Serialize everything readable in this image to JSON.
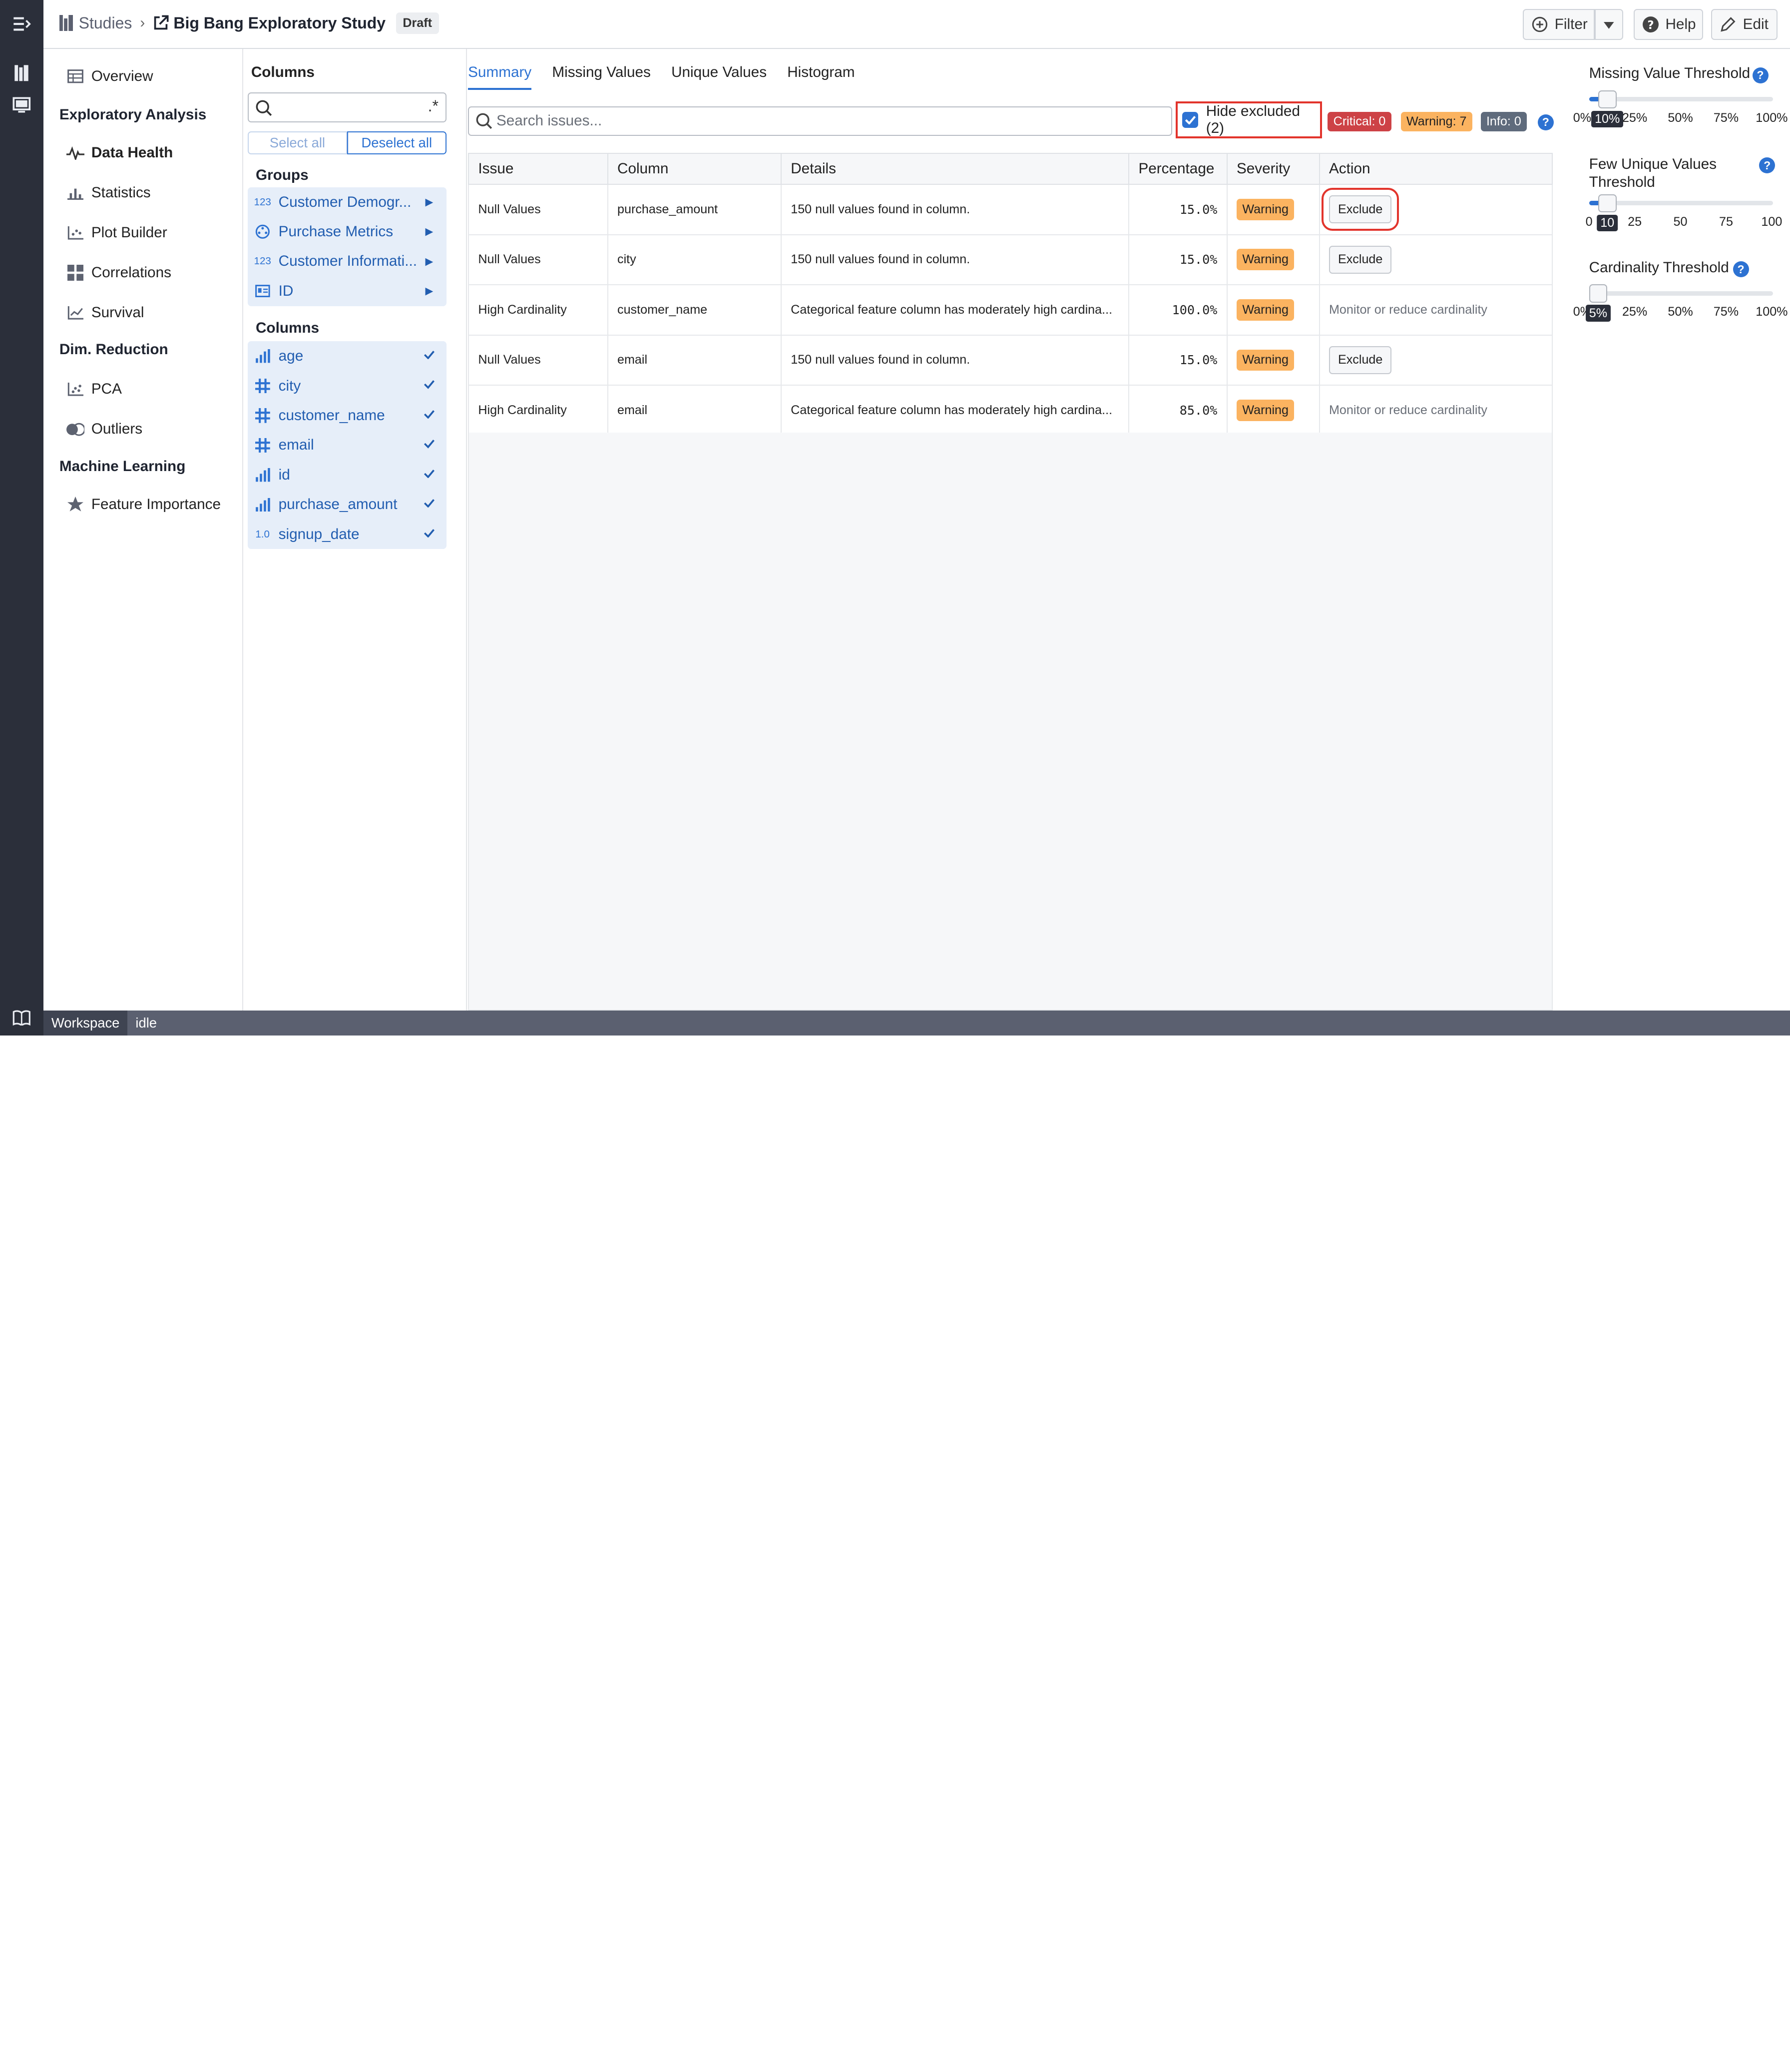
{
  "topbar": {
    "breadcrumb_root": "Studies",
    "study_title": "Big Bang Exploratory Study",
    "status_badge": "Draft",
    "filter_label": "Filter",
    "help_label": "Help",
    "edit_label": "Edit"
  },
  "leftnav": {
    "overview": "Overview",
    "sections": [
      {
        "label": "Exploratory Analysis",
        "items": [
          "Data Health",
          "Statistics",
          "Plot Builder",
          "Correlations",
          "Survival"
        ]
      },
      {
        "label": "Dim. Reduction",
        "items": [
          "PCA",
          "Outliers"
        ]
      },
      {
        "label": "Machine Learning",
        "items": [
          "Feature Importance"
        ]
      }
    ],
    "active_item": "Data Health"
  },
  "columns_panel": {
    "title": "Columns",
    "search_placeholder": "",
    "regex_label": ".*",
    "select_all": "Select all",
    "deselect_all": "Deselect all",
    "groups_title": "Groups",
    "groups": [
      {
        "label": "Customer Demogr...",
        "type_icon": "123"
      },
      {
        "label": "Purchase Metrics",
        "type_icon": "categorical-icon"
      },
      {
        "label": "Customer Informati...",
        "type_icon": "123"
      },
      {
        "label": "ID",
        "type_icon": "id-icon"
      }
    ],
    "columns_title": "Columns",
    "columns": [
      {
        "label": "age",
        "type_icon": "bar-chart-icon"
      },
      {
        "label": "city",
        "type_icon": "grid-icon"
      },
      {
        "label": "customer_name",
        "type_icon": "grid-icon"
      },
      {
        "label": "email",
        "type_icon": "grid-icon"
      },
      {
        "label": "id",
        "type_icon": "bar-chart-icon"
      },
      {
        "label": "purchase_amount",
        "type_icon": "bar-chart-icon"
      },
      {
        "label": "signup_date",
        "type_icon": "1.0"
      }
    ]
  },
  "main": {
    "tabs": [
      "Summary",
      "Missing Values",
      "Unique Values",
      "Histogram"
    ],
    "active_tab": "Summary",
    "search_placeholder": "Search issues...",
    "hide_excluded_label": "Hide excluded (2)",
    "hide_excluded_checked": true,
    "badges": {
      "critical": "Critical: 0",
      "warning": "Warning: 7",
      "info": "Info: 0"
    },
    "table": {
      "headers": [
        "Issue",
        "Column",
        "Details",
        "Percentage",
        "Severity",
        "Action"
      ],
      "rows": [
        {
          "issue": "Null Values",
          "column": "purchase_amount",
          "details": "150 null values found in column.",
          "percentage": "15.0%",
          "severity": "Warning",
          "action": "Exclude"
        },
        {
          "issue": "Null Values",
          "column": "city",
          "details": "150 null values found in column.",
          "percentage": "15.0%",
          "severity": "Warning",
          "action": "Exclude"
        },
        {
          "issue": "High Cardinality",
          "column": "customer_name",
          "details": "Categorical feature column has moderately high cardina...",
          "percentage": "100.0%",
          "severity": "Warning",
          "action": "Monitor or reduce cardinality"
        },
        {
          "issue": "Null Values",
          "column": "email",
          "details": "150 null values found in column.",
          "percentage": "15.0%",
          "severity": "Warning",
          "action": "Exclude"
        },
        {
          "issue": "High Cardinality",
          "column": "email",
          "details": "Categorical feature column has moderately high cardina...",
          "percentage": "85.0%",
          "severity": "Warning",
          "action": "Monitor or reduce cardinality"
        }
      ]
    }
  },
  "thresholds": {
    "missing": {
      "label": "Missing Value Threshold",
      "ticks": [
        "0%",
        "10%",
        "25%",
        "50%",
        "75%",
        "100%"
      ],
      "value": 0.1,
      "current": "10%"
    },
    "few_unique": {
      "label": "Few Unique Values Threshold",
      "ticks": [
        "0",
        "10",
        "25",
        "50",
        "75",
        "100"
      ],
      "value": 10,
      "current": "10"
    },
    "cardinality": {
      "label": "Cardinality Threshold",
      "ticks": [
        "0%",
        "5%",
        "25%",
        "50%",
        "75%",
        "100%"
      ],
      "value": 0.05,
      "current": "5%"
    }
  },
  "statusbar": {
    "workspace": "Workspace",
    "state": "idle"
  },
  "colors": {
    "accent": "#2d72d2",
    "warning": "#fbb360",
    "critical": "#cd4246",
    "info": "#5f6b7c",
    "highlight": "#e2342c"
  }
}
